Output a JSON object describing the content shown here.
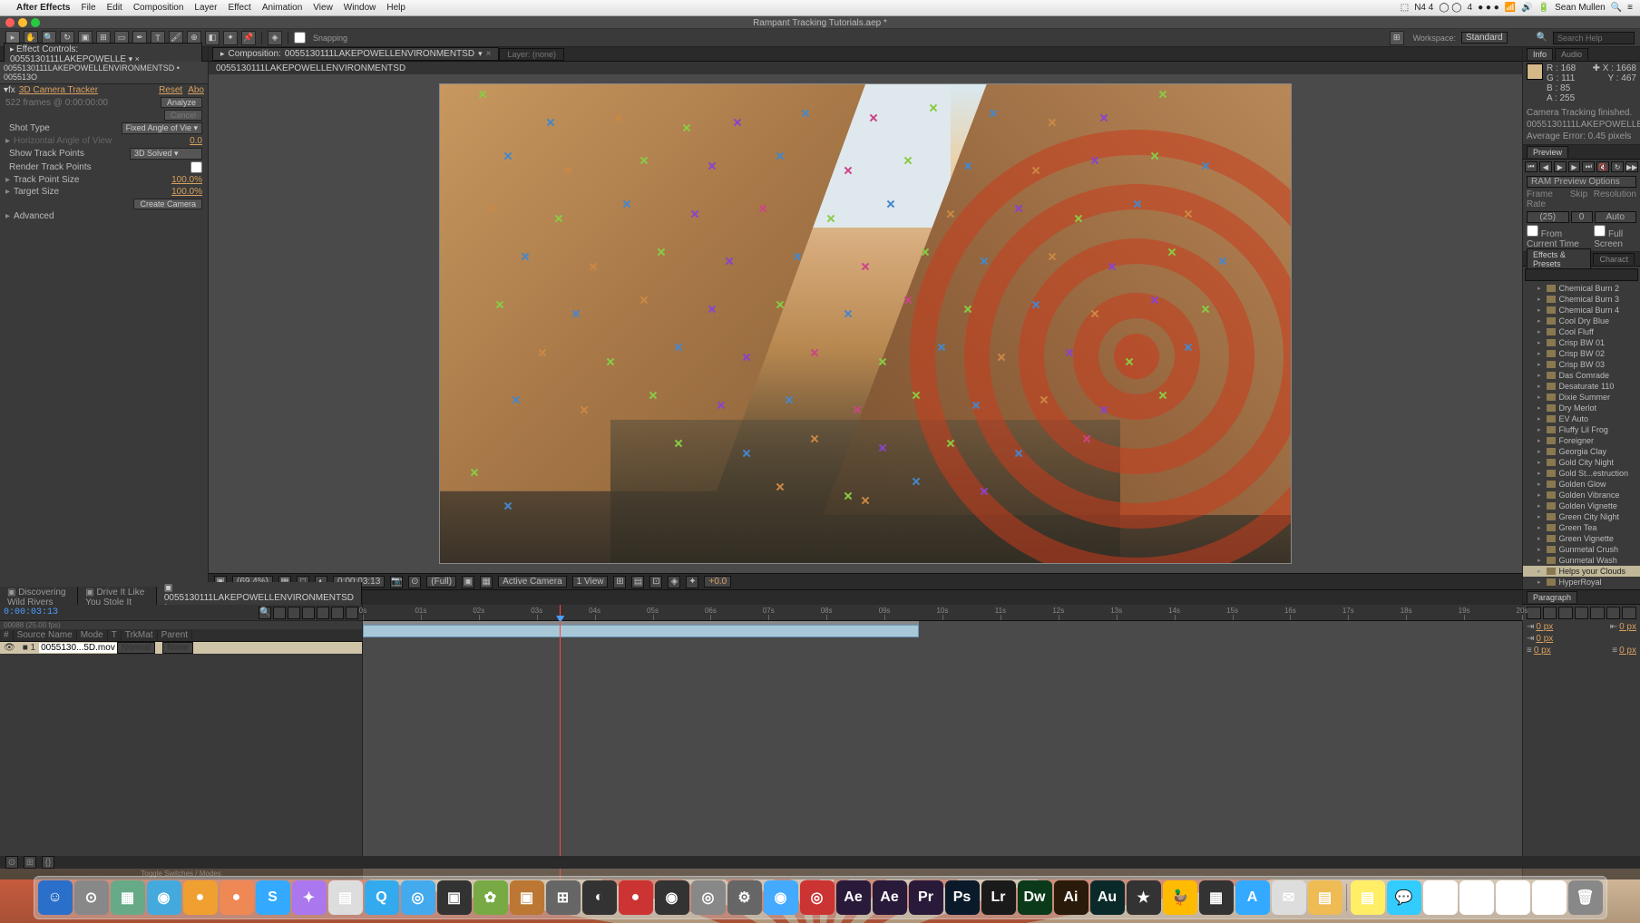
{
  "mac_menubar": {
    "app_name": "After Effects",
    "items": [
      "File",
      "Edit",
      "Composition",
      "Layer",
      "Effect",
      "Animation",
      "View",
      "Window",
      "Help"
    ],
    "right_items": [
      "N4 4",
      "4",
      "Sean Mullen"
    ]
  },
  "window_title": "Rampant Tracking Tutorials.aep *",
  "toolbar": {
    "snapping_label": "Snapping",
    "workspace_label": "Workspace:",
    "workspace_value": "Standard",
    "search_placeholder": "Search Help"
  },
  "left_panel": {
    "tab_label": "Effect Controls: 0055130111LAKEPOWELLE",
    "comp_path": "0055130111LAKEPOWELLENVIRONMENTSD • 005513O",
    "effect_name": "3D Camera Tracker",
    "reset": "Reset",
    "about": "Abo",
    "frames_info": "522 frames @ 0:00:00:00",
    "analyze_btn": "Analyze",
    "cancel_btn": "Cancel",
    "rows": [
      {
        "label": "Shot Type",
        "value": "Fixed Angle of Vie",
        "type": "dropdown"
      },
      {
        "label": "Horizontal Angle of View",
        "value": "0.0",
        "type": "val",
        "dim": true
      },
      {
        "label": "Show Track Points",
        "value": "3D Solved",
        "type": "dropdown"
      },
      {
        "label": "Render Track Points",
        "value": "",
        "type": "checkbox"
      },
      {
        "label": "Track Point Size",
        "value": "100.0%",
        "type": "val"
      },
      {
        "label": "Target Size",
        "value": "100.0%",
        "type": "val"
      }
    ],
    "create_camera_btn": "Create Camera",
    "advanced_label": "Advanced"
  },
  "comp_panel": {
    "tab_prefix": "Composition:",
    "tab_name": "0055130111LAKEPOWELLENVIRONMENTSD",
    "layer_tab": "Layer: (none)",
    "subtab": "0055130111LAKEPOWELLENVIRONMENTSD"
  },
  "viewer_footer": {
    "zoom": "(69.4%)",
    "timecode": "0:00:03:13",
    "res": "(Full)",
    "camera": "Active Camera",
    "views": "1 View",
    "exposure": "+0.0"
  },
  "info_panel": {
    "tab": "Info",
    "tab2": "Audio",
    "r": "R :",
    "r_val": "168",
    "g": "G : 111",
    "b": "B : 85",
    "a": "A : 255",
    "x": "X : 1668",
    "y": "Y : 467",
    "status1": "Camera Tracking finished.",
    "status2": "0055130111LAKEPOWELLENVIRO",
    "status3": "Average Error: 0.45 pixels"
  },
  "preview_panel": {
    "tab": "Preview",
    "options_label": "RAM Preview Options",
    "col1": "Frame Rate",
    "col2": "Skip",
    "col3": "Resolution",
    "v1": "(25)",
    "v2": "0",
    "v3": "Auto",
    "chk1": "From Current Time",
    "chk2": "Full Screen"
  },
  "effects_panel": {
    "tab": "Effects & Presets",
    "tab2": "Charact",
    "search_placeholder": "",
    "presets": [
      "Chemical Burn 2",
      "Chemical Burn 3",
      "Chemical Burn 4",
      "Cool Dry Blue",
      "Cool Fluff",
      "Crisp BW 01",
      "Crisp BW 02",
      "Crisp BW 03",
      "Das Comrade",
      "Desaturate 110",
      "Dixie Summer",
      "Dry Merlot",
      "EV Auto",
      "Fluffy Lil Frog",
      "Foreigner",
      "Georgia Clay",
      "Gold City Night",
      "Gold St...estruction",
      "Golden Glow",
      "Golden Vibrance",
      "Golden Vignette",
      "Green City Night",
      "Green Tea",
      "Green Vignette",
      "Gunmetal Crush",
      "Gunmetal Wash",
      "Helps your Clouds",
      "HyperRoyal"
    ],
    "selected_index": 26
  },
  "timeline": {
    "tabs": [
      "Discovering Wild Rivers",
      "Drive It Like You Stole It",
      "0055130111LAKEPOWELLENVIRONMENTSD *"
    ],
    "active_tab": 2,
    "timecode": "0:00:03:13",
    "frames": "00088 (25.00 fps)",
    "cols": [
      "#",
      "Source Name",
      "Mode",
      "T",
      "TrkMat",
      "Parent"
    ],
    "layer_name": "0055130...5D.mov",
    "layer_mode": "Normal",
    "layer_parent": "None",
    "ticks": [
      "0s",
      "01s",
      "02s",
      "03s",
      "04s",
      "05s",
      "06s",
      "07s",
      "08s",
      "09s",
      "10s",
      "11s",
      "12s",
      "13s",
      "14s",
      "15s",
      "16s",
      "17s",
      "18s",
      "19s",
      "20s"
    ],
    "footer": "Toggle Switches / Modes"
  },
  "paragraph_panel": {
    "tab": "Paragraph",
    "indent_left": "0 px",
    "indent_right": "0 px",
    "indent_first": "0 px",
    "space_before": "0 px",
    "space_after": "0 px"
  },
  "dock_icons": [
    {
      "bg": "#2a6fc9",
      "txt": "☺"
    },
    {
      "bg": "#888",
      "txt": "⊙"
    },
    {
      "bg": "#6a8",
      "txt": "▦"
    },
    {
      "bg": "#4ad",
      "txt": "◉"
    },
    {
      "bg": "#f0a030",
      "txt": "●"
    },
    {
      "bg": "#e85",
      "txt": "●"
    },
    {
      "bg": "#3af",
      "txt": "S"
    },
    {
      "bg": "#a7e",
      "txt": "✦"
    },
    {
      "bg": "#ddd",
      "txt": "▤"
    },
    {
      "bg": "#3ae",
      "txt": "Q"
    },
    {
      "bg": "#4ae",
      "txt": "◎"
    },
    {
      "bg": "#333",
      "txt": "▣"
    },
    {
      "bg": "#7a4",
      "txt": "✿"
    },
    {
      "bg": "#b73",
      "txt": "▣"
    },
    {
      "bg": "#666",
      "txt": "⊞"
    },
    {
      "bg": "#333",
      "txt": "◐"
    },
    {
      "bg": "#c33",
      "txt": "●"
    },
    {
      "bg": "#333",
      "txt": "◉"
    },
    {
      "bg": "#888",
      "txt": "◎"
    },
    {
      "bg": "#666",
      "txt": "⚙"
    },
    {
      "bg": "#4af",
      "txt": "◉"
    },
    {
      "bg": "#c33",
      "txt": "◎"
    },
    {
      "bg": "#2a1a3a",
      "txt": "Ae"
    },
    {
      "bg": "#2a1a3a",
      "txt": "Ae"
    },
    {
      "bg": "#2a1a3a",
      "txt": "Pr"
    },
    {
      "bg": "#0a1a2a",
      "txt": "Ps"
    },
    {
      "bg": "#1a1a1a",
      "txt": "Lr"
    },
    {
      "bg": "#0a3a1a",
      "txt": "Dw"
    },
    {
      "bg": "#2a1a0a",
      "txt": "Ai"
    },
    {
      "bg": "#0a2a2a",
      "txt": "Au"
    },
    {
      "bg": "#333",
      "txt": "★"
    },
    {
      "bg": "#fb0",
      "txt": "🦆"
    },
    {
      "bg": "#333",
      "txt": "▦"
    },
    {
      "bg": "#3af",
      "txt": "A"
    },
    {
      "bg": "#ddd",
      "txt": "✉"
    },
    {
      "bg": "#eb5",
      "txt": "▤"
    },
    {
      "bg": "#fe6",
      "txt": "▤"
    },
    {
      "bg": "#3cf",
      "txt": "💬"
    },
    {
      "bg": "#fff",
      "txt": ""
    },
    {
      "bg": "#fff",
      "txt": ""
    },
    {
      "bg": "#fff",
      "txt": ""
    },
    {
      "bg": "#fff",
      "txt": ""
    },
    {
      "bg": "#888",
      "txt": "🗑"
    }
  ],
  "track_points": [
    [
      5,
      2,
      "#8c4"
    ],
    [
      13,
      8,
      "#48c"
    ],
    [
      21,
      7,
      "#c84"
    ],
    [
      29,
      9,
      "#8c4"
    ],
    [
      35,
      8,
      "#84c"
    ],
    [
      43,
      6,
      "#48c"
    ],
    [
      51,
      7,
      "#c48"
    ],
    [
      58,
      5,
      "#8c4"
    ],
    [
      65,
      6,
      "#48c"
    ],
    [
      72,
      8,
      "#c84"
    ],
    [
      78,
      7,
      "#84c"
    ],
    [
      85,
      2,
      "#8c4"
    ],
    [
      8,
      15,
      "#48c"
    ],
    [
      15,
      18,
      "#c84"
    ],
    [
      24,
      16,
      "#8c4"
    ],
    [
      32,
      17,
      "#84c"
    ],
    [
      40,
      15,
      "#48c"
    ],
    [
      48,
      18,
      "#c48"
    ],
    [
      55,
      16,
      "#8c4"
    ],
    [
      62,
      17,
      "#48c"
    ],
    [
      70,
      18,
      "#c84"
    ],
    [
      77,
      16,
      "#84c"
    ],
    [
      84,
      15,
      "#8c4"
    ],
    [
      90,
      17,
      "#48c"
    ],
    [
      6,
      26,
      "#c84"
    ],
    [
      14,
      28,
      "#8c4"
    ],
    [
      22,
      25,
      "#48c"
    ],
    [
      30,
      27,
      "#84c"
    ],
    [
      38,
      26,
      "#c48"
    ],
    [
      46,
      28,
      "#8c4"
    ],
    [
      53,
      25,
      "#48c"
    ],
    [
      60,
      27,
      "#c84"
    ],
    [
      68,
      26,
      "#84c"
    ],
    [
      75,
      28,
      "#8c4"
    ],
    [
      82,
      25,
      "#48c"
    ],
    [
      88,
      27,
      "#c84"
    ],
    [
      10,
      36,
      "#48c"
    ],
    [
      18,
      38,
      "#c84"
    ],
    [
      26,
      35,
      "#8c4"
    ],
    [
      34,
      37,
      "#84c"
    ],
    [
      42,
      36,
      "#48c"
    ],
    [
      50,
      38,
      "#c48"
    ],
    [
      57,
      35,
      "#8c4"
    ],
    [
      64,
      37,
      "#48c"
    ],
    [
      72,
      36,
      "#c84"
    ],
    [
      79,
      38,
      "#84c"
    ],
    [
      86,
      35,
      "#8c4"
    ],
    [
      92,
      37,
      "#48c"
    ],
    [
      7,
      46,
      "#8c4"
    ],
    [
      16,
      48,
      "#48c"
    ],
    [
      24,
      45,
      "#c84"
    ],
    [
      32,
      47,
      "#84c"
    ],
    [
      40,
      46,
      "#8c4"
    ],
    [
      48,
      48,
      "#48c"
    ],
    [
      55,
      45,
      "#c48"
    ],
    [
      62,
      47,
      "#8c4"
    ],
    [
      70,
      46,
      "#48c"
    ],
    [
      77,
      48,
      "#c84"
    ],
    [
      84,
      45,
      "#84c"
    ],
    [
      90,
      47,
      "#8c4"
    ],
    [
      12,
      56,
      "#c84"
    ],
    [
      20,
      58,
      "#8c4"
    ],
    [
      28,
      55,
      "#48c"
    ],
    [
      36,
      57,
      "#84c"
    ],
    [
      44,
      56,
      "#c48"
    ],
    [
      52,
      58,
      "#8c4"
    ],
    [
      59,
      55,
      "#48c"
    ],
    [
      66,
      57,
      "#c84"
    ],
    [
      74,
      56,
      "#84c"
    ],
    [
      81,
      58,
      "#8c4"
    ],
    [
      88,
      55,
      "#48c"
    ],
    [
      9,
      66,
      "#48c"
    ],
    [
      17,
      68,
      "#c84"
    ],
    [
      25,
      65,
      "#8c4"
    ],
    [
      33,
      67,
      "#84c"
    ],
    [
      41,
      66,
      "#48c"
    ],
    [
      49,
      68,
      "#c48"
    ],
    [
      56,
      65,
      "#8c4"
    ],
    [
      63,
      67,
      "#48c"
    ],
    [
      71,
      66,
      "#c84"
    ],
    [
      78,
      68,
      "#84c"
    ],
    [
      85,
      65,
      "#8c4"
    ],
    [
      28,
      75,
      "#8c4"
    ],
    [
      36,
      77,
      "#48c"
    ],
    [
      44,
      74,
      "#c84"
    ],
    [
      52,
      76,
      "#84c"
    ],
    [
      60,
      75,
      "#8c4"
    ],
    [
      68,
      77,
      "#48c"
    ],
    [
      76,
      74,
      "#c48"
    ],
    [
      40,
      84,
      "#c84"
    ],
    [
      48,
      86,
      "#8c4"
    ],
    [
      56,
      83,
      "#48c"
    ],
    [
      64,
      85,
      "#84c"
    ],
    [
      4,
      81,
      "#8c4"
    ],
    [
      8,
      88,
      "#48c"
    ],
    [
      50,
      87,
      "#c84"
    ]
  ]
}
